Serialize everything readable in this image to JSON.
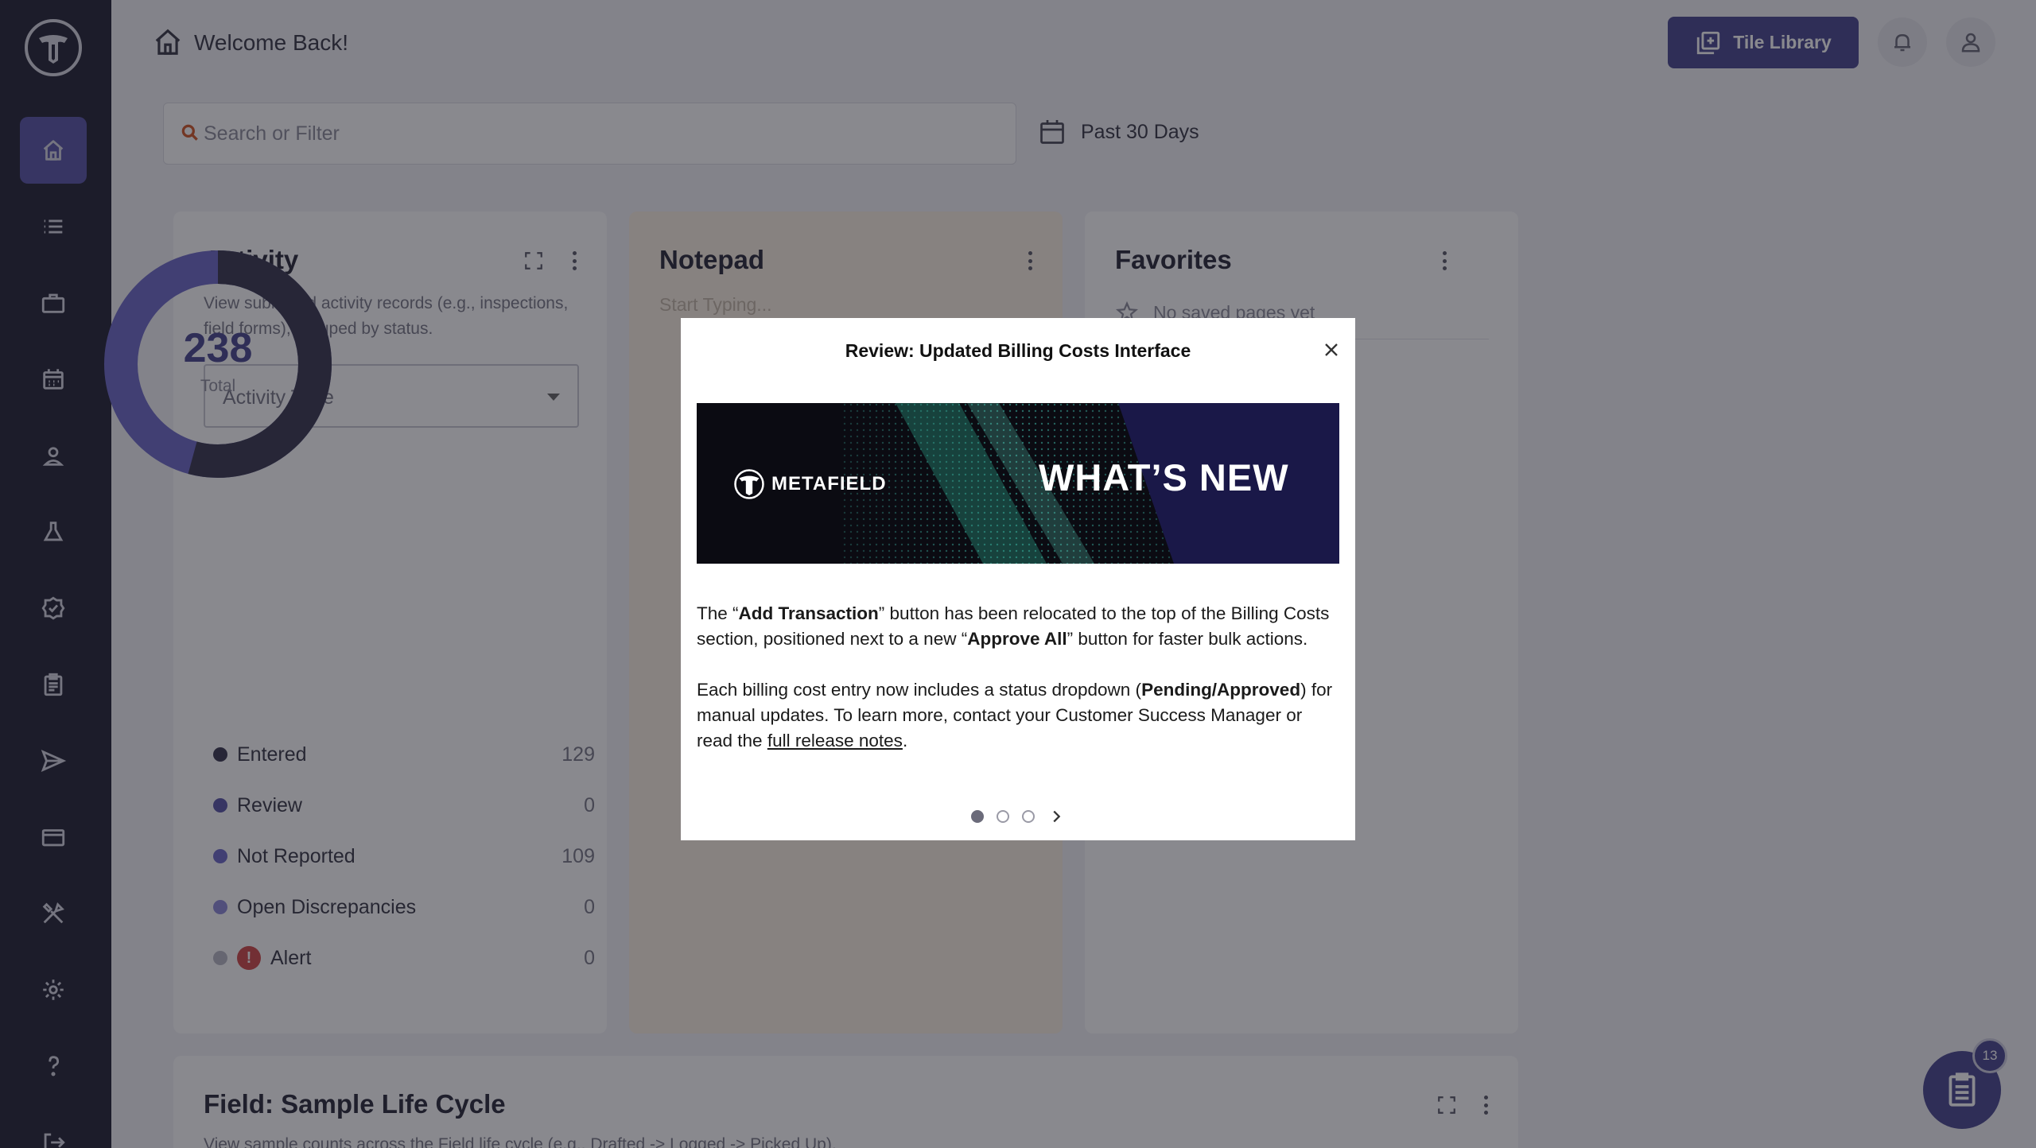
{
  "header": {
    "title": "Welcome Back!",
    "tile_library_label": "Tile Library"
  },
  "search": {
    "placeholder": "Search or Filter"
  },
  "date_filter": {
    "label": "Past 30 Days"
  },
  "activity_card": {
    "title": "Activity",
    "description": "View submitted activity records (e.g., inspections, field forms), grouped by status.",
    "select_placeholder": "Activity Type",
    "total": "238",
    "total_label": "Total",
    "legend": [
      {
        "label": "Entered",
        "value": "129",
        "color": "#3a3850"
      },
      {
        "label": "Review",
        "value": "0",
        "color": "#5a56a8"
      },
      {
        "label": "Not Reported",
        "value": "109",
        "color": "#6f6bc9"
      },
      {
        "label": "Open Discrepancies",
        "value": "0",
        "color": "#8f8bd9"
      },
      {
        "label": "Alert",
        "value": "0",
        "color": "#b8b8c4"
      }
    ],
    "donut_fractions": {
      "entered": 0.542,
      "not_reported": 0.458
    },
    "colors": {
      "entered": "#3a3850",
      "not_reported": "#6f6bc9"
    }
  },
  "notepad_card": {
    "title": "Notepad",
    "placeholder": "Start Typing..."
  },
  "favorites_card": {
    "title": "Favorites",
    "empty_text": "No saved pages yet"
  },
  "lifecycle_card": {
    "title": "Field: Sample Life Cycle",
    "description": "View sample counts across the Field life cycle (e.g., Drafted -> Logged -> Picked Up)."
  },
  "modal": {
    "title": "Review: Updated Billing Costs Interface",
    "banner_brand": "METAFIELD",
    "banner_headline": "WHAT’S NEW",
    "p1_a": "The “",
    "p1_b": "Add Transaction",
    "p1_c": "” button has been relocated to the top of the Billing Costs section, positioned next to a new “",
    "p1_d": "Approve All",
    "p1_e": "” button for faster bulk actions.",
    "p2_a": "Each billing cost entry now includes a status dropdown (",
    "p2_b": "Pending/Approved",
    "p2_c": ") for manual updates. To learn more, contact your Customer Success Manager or read the ",
    "p2_link": "full release notes",
    "p2_d": "."
  },
  "fab": {
    "badge": "13"
  },
  "icons": {
    "sidebar": [
      "home-icon",
      "list-icon",
      "briefcase-icon",
      "calendar-icon",
      "user-badge-icon",
      "flask-icon",
      "check-badge-icon",
      "clipboard-icon",
      "send-icon",
      "credit-card-icon",
      "tools-icon",
      "gear-icon",
      "help-icon",
      "logout-icon"
    ]
  }
}
